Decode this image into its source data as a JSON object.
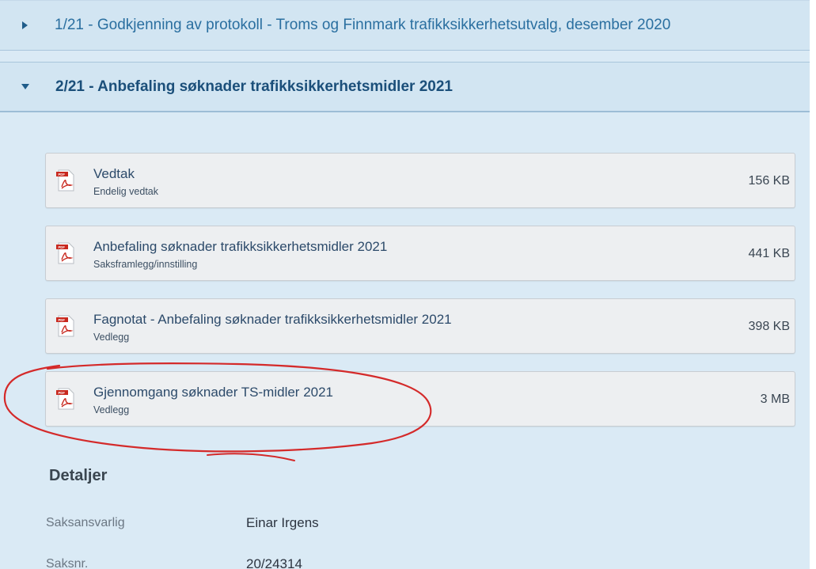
{
  "accordion": {
    "item1_title": "1/21 - Godkjenning av protokoll - Troms og Finnmark trafikksikkerhetsutvalg, desember 2020",
    "item2_title": "2/21 - Anbefaling søknader trafikksikkerhetsmidler 2021"
  },
  "documents": [
    {
      "title": "Vedtak",
      "subtitle": "Endelig vedtak",
      "size": "156 KB"
    },
    {
      "title": "Anbefaling søknader trafikksikkerhetsmidler 2021",
      "subtitle": "Saksframlegg/innstilling",
      "size": "441 KB"
    },
    {
      "title": "Fagnotat - Anbefaling søknader trafikksikkerhetsmidler 2021",
      "subtitle": "Vedlegg",
      "size": "398 KB"
    },
    {
      "title": "Gjennomgang søknader TS-midler 2021",
      "subtitle": "Vedlegg",
      "size": "3 MB"
    }
  ],
  "details": {
    "heading": "Detaljer",
    "rows": [
      {
        "label": "Saksansvarlig",
        "value": "Einar Irgens"
      },
      {
        "label": "Saksnr.",
        "value": "20/24314"
      }
    ]
  },
  "icons": {
    "pdf": "pdf-file-icon",
    "collapsed": "chevron-right-icon",
    "expanded": "chevron-down-icon"
  },
  "colors": {
    "panel_bg": "#daeaf5",
    "header_bg": "#d2e5f2",
    "link_blue": "#2a6fa0",
    "annotation_red": "#d42a2a"
  }
}
